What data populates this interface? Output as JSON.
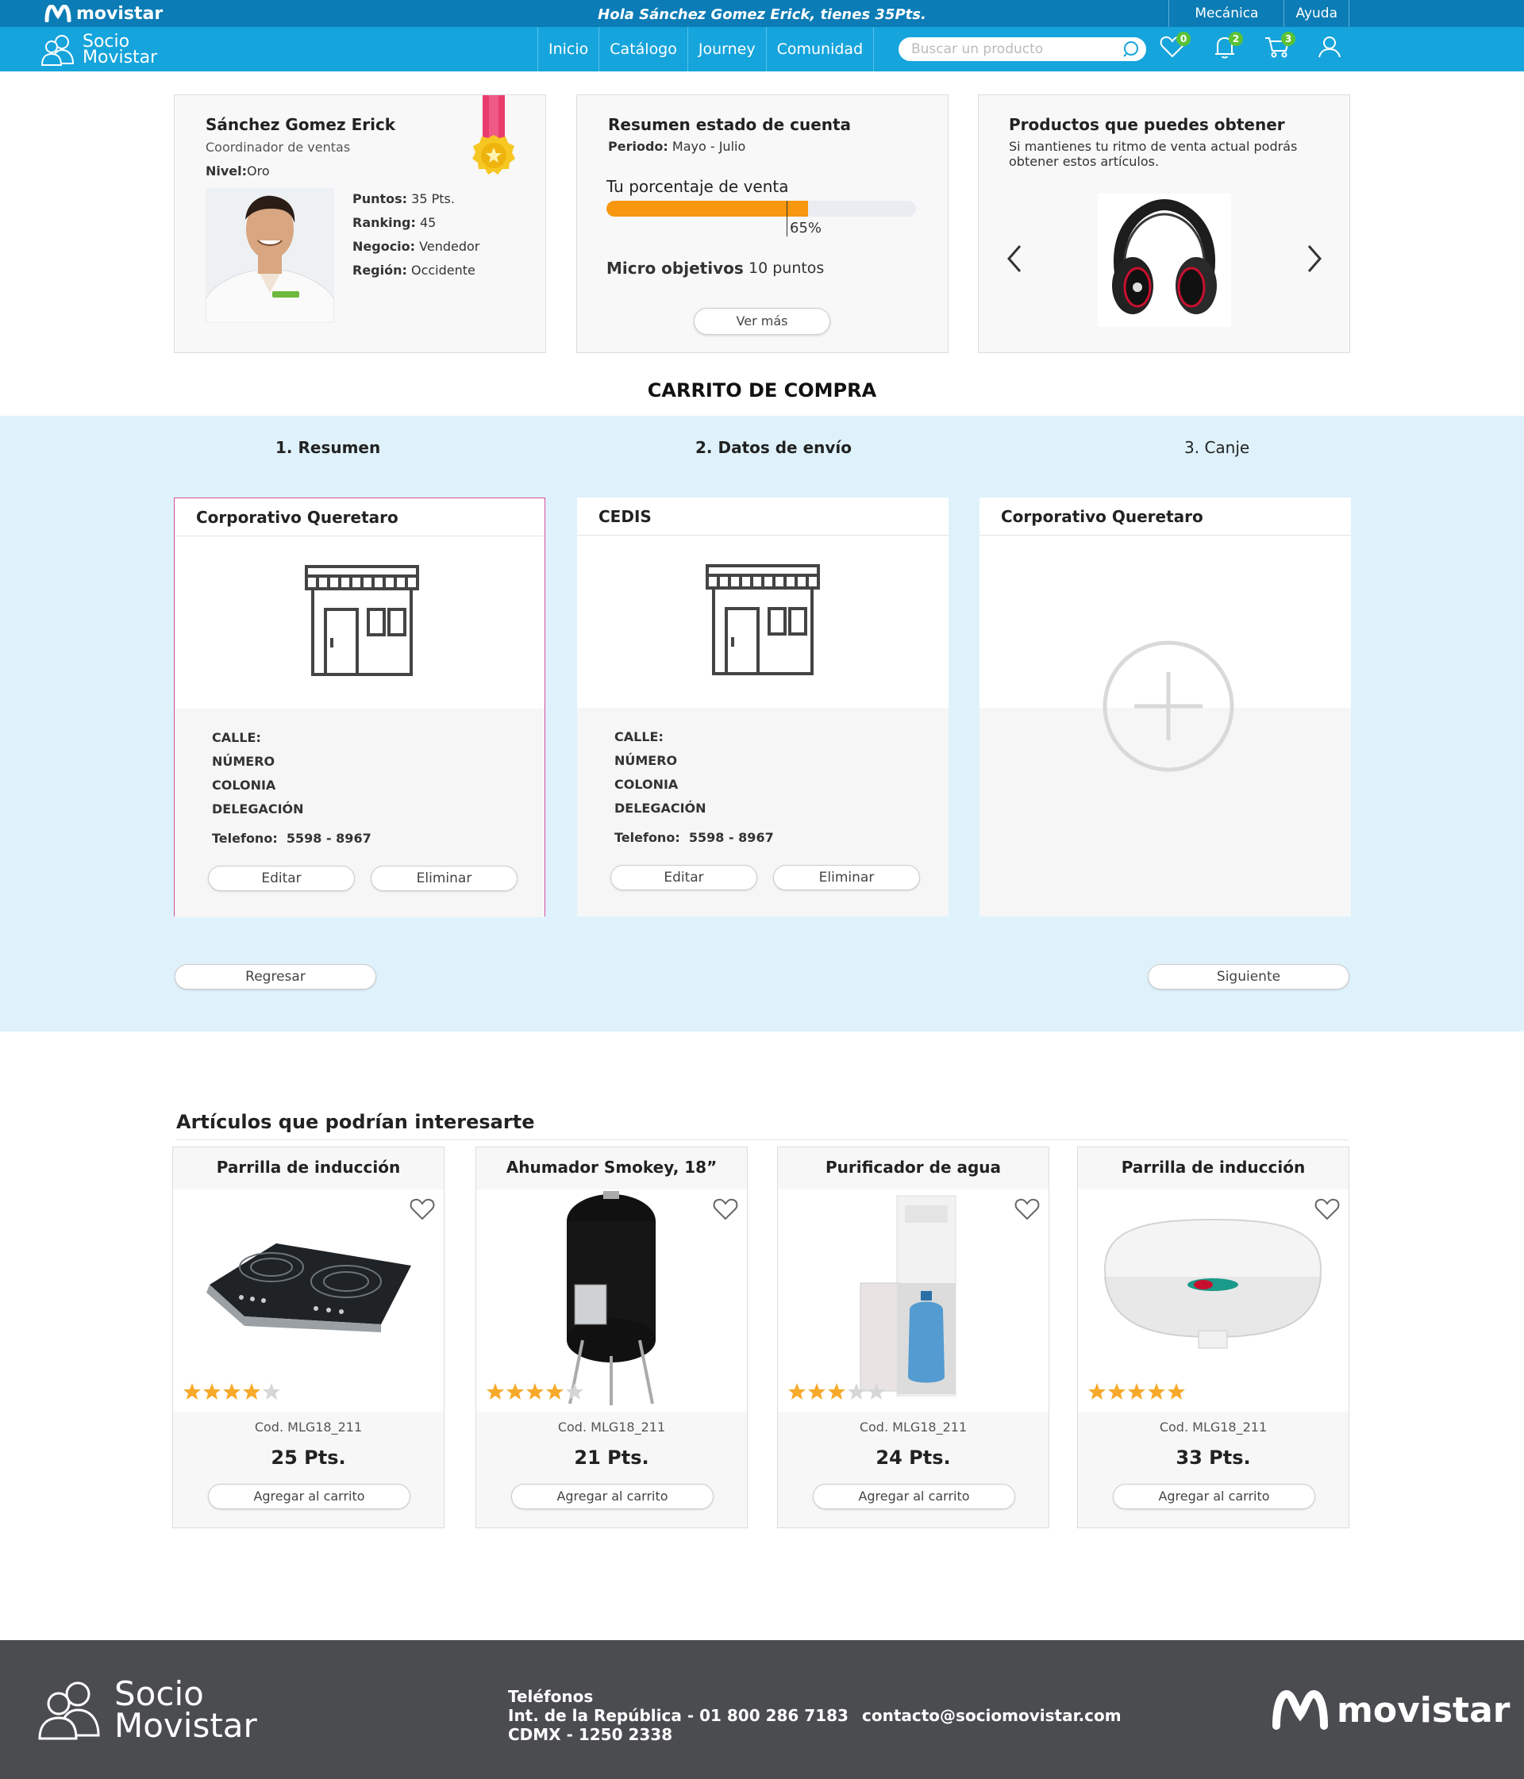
{
  "topbar": {
    "brand": "movistar",
    "greeting": "Hola Sánchez Gomez Erick, tienes 35Pts.",
    "links": [
      "Mecánica",
      "Ayuda"
    ]
  },
  "navbar": {
    "socio_line1": "Socio",
    "socio_line2": "Movistar",
    "menu": [
      "Inicio",
      "Catálogo",
      "Journey",
      "Comunidad"
    ],
    "search_placeholder": "Buscar un producto",
    "favorites_count": "0",
    "notifications_count": "2",
    "cart_count": "3"
  },
  "profile": {
    "name": "Sánchez Gomez Erick",
    "role": "Coordinador de ventas",
    "level_label": "Nivel:",
    "level": "Oro",
    "points_label": "Puntos:",
    "points": "35 Pts.",
    "ranking_label": "Ranking:",
    "ranking": "45",
    "business_label": "Negocio:",
    "business": "Vendedor",
    "region_label": "Región:",
    "region": "Occidente"
  },
  "account": {
    "title": "Resumen estado de cuenta",
    "period_label": "Periodo:",
    "period": "Mayo - Julio",
    "sales_label": "Tu porcentaje de venta",
    "sales_percent": 65,
    "sales_percent_text": "65%",
    "micro_label": "Micro objetivos",
    "micro_value": "10 puntos",
    "more_button": "Ver más"
  },
  "suggested": {
    "title": "Productos que puedes obtener",
    "description": "Si mantienes tu ritmo de venta actual podrás obtener estos artículos."
  },
  "cart": {
    "title": "CARRITO DE COMPRA",
    "steps": [
      "1. Resumen",
      "2. Datos de envío",
      "3. Canje"
    ],
    "addresses": [
      {
        "name": "Corporativo Queretaro",
        "fields": [
          "CALLE:",
          "NÚMERO",
          "COLONIA",
          "DELEGACIÓN"
        ],
        "phone_label": "Telefono:",
        "phone": "5598 - 8967",
        "edit": "Editar",
        "delete": "Eliminar"
      },
      {
        "name": "CEDIS",
        "fields": [
          "CALLE:",
          "NÚMERO",
          "COLONIA",
          "DELEGACIÓN"
        ],
        "phone_label": "Telefono:",
        "phone": "5598 - 8967",
        "edit": "Editar",
        "delete": "Eliminar"
      },
      {
        "name": "Corporativo Queretaro"
      }
    ],
    "back_button": "Regresar",
    "next_button": "Siguiente"
  },
  "related": {
    "title": "Artículos que podrían interesarte",
    "products": [
      {
        "name": "Parrilla de inducción",
        "rating": 4,
        "code": "Cod. MLG18_211",
        "price": "25 Pts.",
        "add": "Agregar al carrito"
      },
      {
        "name": "Ahumador Smokey, 18”",
        "rating": 4,
        "code": "Cod. MLG18_211",
        "price": "21 Pts.",
        "add": "Agregar al carrito"
      },
      {
        "name": "Purificador de agua",
        "rating": 3,
        "code": "Cod. MLG18_211",
        "price": "24 Pts.",
        "add": "Agregar al carrito"
      },
      {
        "name": "Parrilla de inducción",
        "rating": 5,
        "code": "Cod. MLG18_211",
        "price": "33 Pts.",
        "add": "Agregar al carrito"
      }
    ]
  },
  "footer": {
    "socio_line1": "Socio",
    "socio_line2": "Movistar",
    "phones_title": "Teléfonos",
    "phone1": "Int. de la República - 01 800 286 7183",
    "phone2": "CDMX - 1250 2338",
    "email": "contacto@sociomovistar.com",
    "brand": "movistar"
  },
  "colors": {
    "topbar": "#0b7cb5",
    "navbar": "#16a4dc",
    "progress": "#f7960f",
    "badge": "#5bc236",
    "section_bg": "#dff2fb",
    "selected_border": "#d54ea0",
    "footer": "#4b4c50",
    "star": "#f7a92b"
  }
}
